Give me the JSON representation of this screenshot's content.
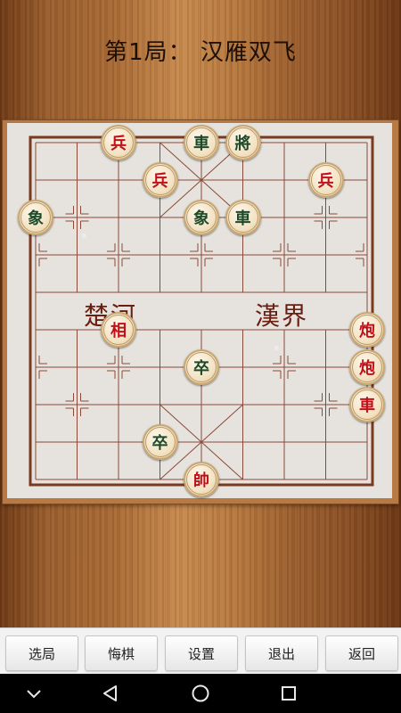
{
  "title": "第1局： 汉雁双飞",
  "river": {
    "left": "楚河",
    "right": "漢界"
  },
  "pieces": [
    {
      "label": "兵",
      "side": "red",
      "file": 2,
      "rank": 0
    },
    {
      "label": "車",
      "side": "black",
      "file": 4,
      "rank": 0
    },
    {
      "label": "將",
      "side": "black",
      "file": 5,
      "rank": 0
    },
    {
      "label": "兵",
      "side": "red",
      "file": 3,
      "rank": 1
    },
    {
      "label": "兵",
      "side": "red",
      "file": 7,
      "rank": 1
    },
    {
      "label": "象",
      "side": "black",
      "file": 0,
      "rank": 2
    },
    {
      "label": "象",
      "side": "black",
      "file": 4,
      "rank": 2
    },
    {
      "label": "車",
      "side": "black",
      "file": 5,
      "rank": 2
    },
    {
      "label": "相",
      "side": "red",
      "file": 2,
      "rank": 5
    },
    {
      "label": "炮",
      "side": "red",
      "file": 8,
      "rank": 5
    },
    {
      "label": "卒",
      "side": "black",
      "file": 4,
      "rank": 6
    },
    {
      "label": "炮",
      "side": "red",
      "file": 8,
      "rank": 6
    },
    {
      "label": "車",
      "side": "red",
      "file": 8,
      "rank": 7
    },
    {
      "label": "卒",
      "side": "black",
      "file": 3,
      "rank": 8
    },
    {
      "label": "帥",
      "side": "red",
      "file": 4,
      "rank": 9
    }
  ],
  "buttons": [
    "选局",
    "悔棋",
    "设置",
    "退出",
    "返回"
  ],
  "nav": [
    "back-chevron-icon",
    "back-triangle-icon",
    "home-circle-icon",
    "recents-square-icon"
  ],
  "colors": {
    "red_piece": "#c2101a",
    "black_piece": "#1e4a2a",
    "board_line": "#8a4a3a"
  }
}
